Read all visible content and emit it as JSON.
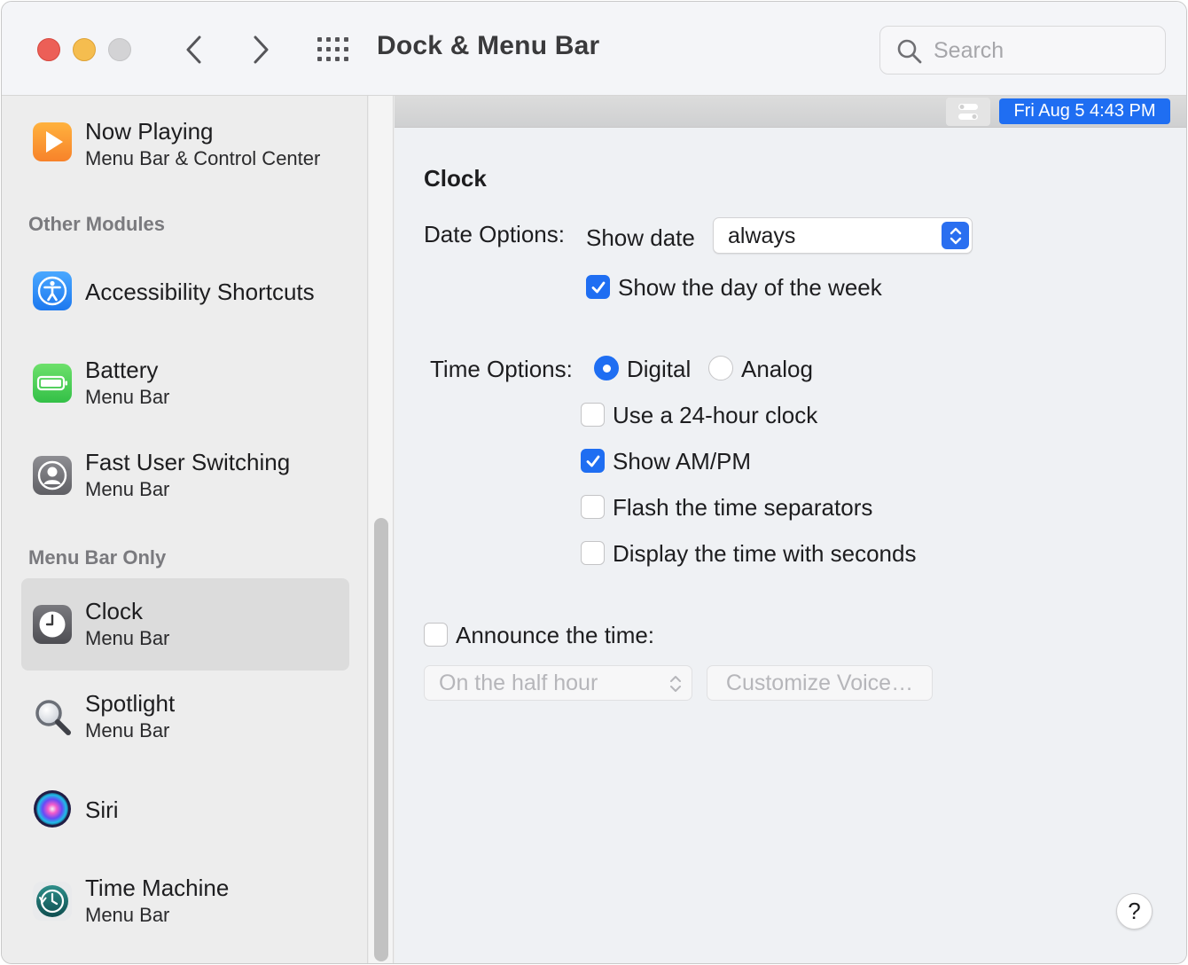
{
  "window": {
    "title": "Dock & Menu Bar",
    "search_placeholder": "Search"
  },
  "sidebar": {
    "top_item": {
      "title": "Now Playing",
      "subtitle": "Menu Bar & Control Center",
      "icon": "play-icon"
    },
    "other_modules_header": "Other Modules",
    "other_modules": [
      {
        "title": "Accessibility Shortcuts",
        "subtitle": "",
        "icon": "accessibility-icon"
      },
      {
        "title": "Battery",
        "subtitle": "Menu Bar",
        "icon": "battery-icon"
      },
      {
        "title": "Fast User Switching",
        "subtitle": "Menu Bar",
        "icon": "user-icon"
      }
    ],
    "menu_bar_only_header": "Menu Bar Only",
    "menu_bar_only": [
      {
        "title": "Clock",
        "subtitle": "Menu Bar",
        "icon": "clock-icon",
        "selected": true
      },
      {
        "title": "Spotlight",
        "subtitle": "Menu Bar",
        "icon": "spotlight-icon"
      },
      {
        "title": "Siri",
        "subtitle": "",
        "icon": "siri-icon"
      },
      {
        "title": "Time Machine",
        "subtitle": "Menu Bar",
        "icon": "time-machine-icon"
      }
    ]
  },
  "menubar_preview": {
    "clock_text": "Fri Aug 5  4:43 PM"
  },
  "clock": {
    "section_title": "Clock",
    "date_options_label": "Date Options:",
    "show_date_label": "Show date",
    "show_date_value": "always",
    "show_day_of_week": {
      "label": "Show the day of the week",
      "checked": true
    },
    "time_options_label": "Time Options:",
    "time_style": {
      "digital_label": "Digital",
      "analog_label": "Analog",
      "selected": "Digital"
    },
    "use_24_hour": {
      "label": "Use a 24-hour clock",
      "checked": false
    },
    "show_am_pm": {
      "label": "Show AM/PM",
      "checked": true
    },
    "flash_separators": {
      "label": "Flash the time separators",
      "checked": false
    },
    "show_seconds": {
      "label": "Display the time with seconds",
      "checked": false
    },
    "announce_time": {
      "label": "Announce the time:",
      "checked": false
    },
    "announce_interval": "On the half hour",
    "customize_voice_label": "Customize Voice…",
    "help_label": "?"
  },
  "colors": {
    "accent": "#1f6ef2",
    "traffic_red": "#ec5f57",
    "traffic_yellow": "#f5bd4f",
    "sidebar_selected": "#dcdcdc"
  }
}
